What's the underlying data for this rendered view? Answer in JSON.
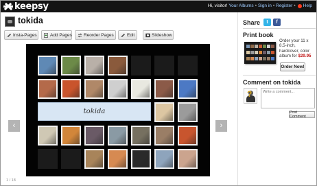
{
  "site": {
    "logo_text": "keepsy"
  },
  "header": {
    "greeting": "Hi, visitor!",
    "links": [
      "Your Albums",
      "Sign in",
      "Register",
      "Help"
    ],
    "separators": [
      "•",
      "•",
      "•"
    ]
  },
  "album": {
    "title": "tokida",
    "banner_text": "tokida"
  },
  "toolbar": [
    {
      "label": "Insta-Pages",
      "icon": "pencil-icon"
    },
    {
      "label": "Add Pages",
      "icon": "add-page-icon"
    },
    {
      "label": "Reorder Pages",
      "icon": "reorder-icon"
    },
    {
      "label": "Edit",
      "icon": "pencil-icon"
    },
    {
      "label": "Slideshow",
      "icon": "slideshow-icon"
    }
  ],
  "viewer": {
    "prev_label": "‹",
    "next_label": "›",
    "pager": "1 / 18",
    "rows": [
      [
        "photo",
        "photo",
        "photo",
        "photo",
        "empty",
        "empty",
        "empty"
      ],
      [
        "photo",
        "photo",
        "photo",
        "photo",
        "photo",
        "photo",
        "photo"
      ],
      [
        "banner",
        "photo",
        "photo"
      ],
      [
        "photo",
        "photo",
        "photo",
        "photo",
        "photo",
        "photo",
        "photo"
      ],
      [
        "empty",
        "empty",
        "photo",
        "photo",
        "photo",
        "photo",
        "photo"
      ]
    ],
    "photo_colors": [
      [
        "#5f89b5",
        "#6c8a48",
        "#b9b0a8",
        "#8a5a3c"
      ],
      [
        "#b46a4a",
        "#c9542c",
        "#b08868",
        "#cfcfcf",
        "#e8e8e0",
        "#8b5a48",
        "#4c79c4"
      ],
      [
        "#dcc6a2",
        "#9b9b9b"
      ],
      [
        "#cfc8b4",
        "#d2863a",
        "#6a5a66",
        "#8a9aa4",
        "#767060",
        "#9a7e66",
        "#c8552e"
      ],
      [
        "#a8845a",
        "#d68a52",
        "#2a2a2a",
        "#8ea4bc",
        "#cba48e"
      ]
    ]
  },
  "share": {
    "heading": "Share",
    "twitter_glyph": "t",
    "facebook_glyph": "f"
  },
  "print": {
    "heading": "Print book",
    "text_before": "Order your 11 x 8.5-inch, hardcover, color album for",
    "price": "$29.95",
    "button": "Order Now!"
  },
  "comment": {
    "heading": "Comment on tokida",
    "avatar_glyph": "?",
    "placeholder": "Write a comment...",
    "button": "Post Comment"
  },
  "colors": {
    "topbar": "#141414",
    "link": "#9ecbff",
    "help": "#ff3b1f",
    "twitter": "#33b4e8",
    "facebook": "#3b5998",
    "price": "#c01818"
  }
}
